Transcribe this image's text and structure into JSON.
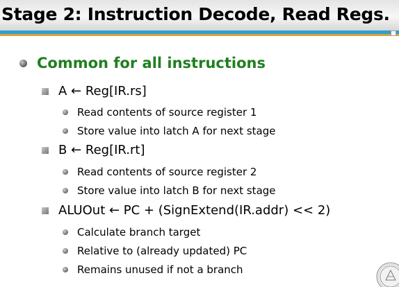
{
  "slide": {
    "title": "Stage 2: Instruction Decode, Read Regs.",
    "heading": "Common for all instructions",
    "items": [
      {
        "text": "A ← Reg[IR.rs]",
        "subitems": [
          "Read contents of source register 1",
          "Store value into latch A for next stage"
        ]
      },
      {
        "text": "B ← Reg[IR.rt]",
        "subitems": [
          "Read contents of source register 2",
          "Store value into latch B for next stage"
        ]
      },
      {
        "text": "ALUOut ← PC + (SignExtend(IR.addr) << 2)",
        "subitems": [
          "Calculate branch target",
          "Relative to (already updated) PC",
          "Remains unused if not a branch"
        ]
      }
    ]
  },
  "colors": {
    "heading": "#1f7f1f",
    "title_rule": "#2f9fd0",
    "title_rule_accent": "#d9a53a"
  },
  "icons": {
    "level1_bullet": "round-bullet-icon",
    "level2_bullet": "square-bullet-icon",
    "level3_bullet": "small-round-bullet-icon",
    "corner": "university-seal-icon"
  }
}
